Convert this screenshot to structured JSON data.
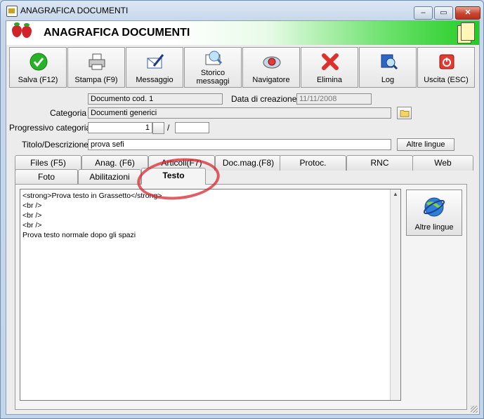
{
  "window": {
    "title": "ANAGRAFICA DOCUMENTI",
    "min": "‒",
    "max": "▭",
    "close": "✕"
  },
  "header": {
    "title": "ANAGRAFICA DOCUMENTI"
  },
  "toolbar": [
    {
      "label": "Salva (F12)",
      "icon": "check-icon"
    },
    {
      "label": "Stampa (F9)",
      "icon": "printer-icon"
    },
    {
      "label": "Messaggio",
      "icon": "message-pen-icon"
    },
    {
      "label": "Storico\nmessaggi",
      "icon": "envelope-search-icon"
    },
    {
      "label": "Navigatore",
      "icon": "compass-icon"
    },
    {
      "label": "Elimina",
      "icon": "red-x-icon"
    },
    {
      "label": "Log",
      "icon": "log-search-icon"
    },
    {
      "label": "Uscita (ESC)",
      "icon": "exit-power-icon"
    }
  ],
  "form": {
    "doc_code": "Documento cod. 1",
    "created_label": "Data di creazione :",
    "created_value": "11/11/2008",
    "category_label": "Categoria :",
    "category_value": "Documenti generici",
    "progressive_label": "Progressivo categoria :",
    "progressive_value": "1",
    "progressive_sep": "/",
    "progressive_btn": "",
    "progressive_suffix": "",
    "title_label": "Titolo/Descrizione :",
    "title_value": "prova sefi",
    "other_langs_btn": "Altre lingue"
  },
  "tabs_row1": [
    "Files (F5)",
    "Anag. (F6)",
    "Articoli(F7)",
    "Doc.mag.(F8)",
    "Protoc.",
    "RNC",
    "Web"
  ],
  "tabs_row2": [
    "Foto",
    "Abilitazioni",
    "Testo"
  ],
  "active_tab": "Testo",
  "editor": {
    "lines": [
      "<strong>Prova testo in Grassetto</strong>",
      "<br />",
      "<br />",
      "<br />",
      "Prova testo normale dopo gli spazi"
    ]
  },
  "side_button": {
    "label": "Altre lingue",
    "icon": "globe-icon"
  },
  "colors": {
    "header_green": "#22cc22",
    "annotation_red": "#d72830",
    "title_bar": "#c6d7ea"
  }
}
